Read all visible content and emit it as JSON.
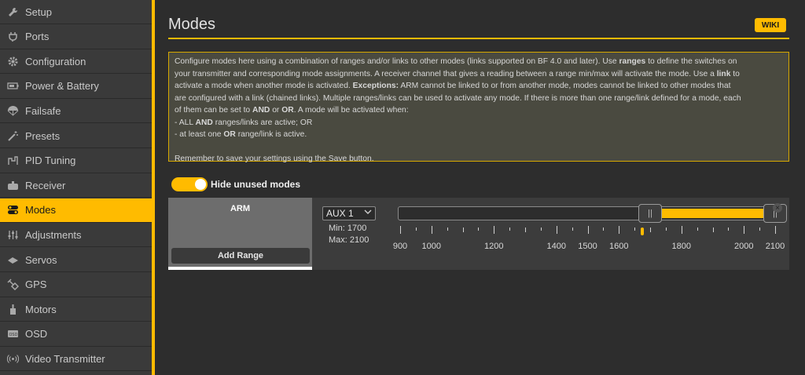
{
  "sidebar": {
    "items": [
      {
        "label": "Setup",
        "icon": "wrench-icon",
        "active": false
      },
      {
        "label": "Ports",
        "icon": "plug-icon",
        "active": false
      },
      {
        "label": "Configuration",
        "icon": "gear-icon",
        "active": false
      },
      {
        "label": "Power & Battery",
        "icon": "battery-icon",
        "active": false
      },
      {
        "label": "Failsafe",
        "icon": "parachute-icon",
        "active": false
      },
      {
        "label": "Presets",
        "icon": "magic-wand-icon",
        "active": false
      },
      {
        "label": "PID Tuning",
        "icon": "pid-tuning-icon",
        "active": false
      },
      {
        "label": "Receiver",
        "icon": "controller-icon",
        "active": false
      },
      {
        "label": "Modes",
        "icon": "modes-toggle-icon",
        "active": true
      },
      {
        "label": "Adjustments",
        "icon": "sliders-icon",
        "active": false
      },
      {
        "label": "Servos",
        "icon": "servo-icon",
        "active": false
      },
      {
        "label": "GPS",
        "icon": "satellite-icon",
        "active": false
      },
      {
        "label": "Motors",
        "icon": "motor-icon",
        "active": false
      },
      {
        "label": "OSD",
        "icon": "osd-icon",
        "active": false
      },
      {
        "label": "Video Transmitter",
        "icon": "broadcast-icon",
        "active": false
      }
    ]
  },
  "header": {
    "title": "Modes",
    "wiki_label": "WIKI"
  },
  "note": {
    "line1_a": "Configure modes here using a combination of ranges and/or links to other modes (links supported on BF 4.0 and later). Use ",
    "line1_b": "ranges",
    "line1_c": " to define the switches on",
    "line2_a": "your transmitter and corresponding mode assignments. A receiver channel that gives a reading between a range min/max will activate the mode. Use a ",
    "line2_b": "link",
    "line2_c": " to",
    "line3_a": "activate a mode when another mode is activated. ",
    "line3_b": "Exceptions:",
    "line3_c": " ARM cannot be linked to or from another mode, modes cannot be linked to other modes that",
    "line4": "are configured with a link (chained links). Multiple ranges/links can be used to activate any mode. If there is more than one range/link defined for a mode, each",
    "line5_a": "of them can be set to ",
    "line5_b": "AND",
    "line5_c": " or ",
    "line5_d": "OR",
    "line5_e": ". A mode will be activated when:",
    "line6_a": "- ALL ",
    "line6_b": "AND",
    "line6_c": " ranges/links are active; OR",
    "line7_a": "- at least one ",
    "line7_b": "OR",
    "line7_c": " range/link is active.",
    "line8": "Remember to save your settings using the Save button."
  },
  "toggle": {
    "label": "Hide unused modes",
    "on": true
  },
  "mode": {
    "name": "ARM",
    "add_range_label": "Add Range",
    "channel": "AUX 1",
    "min_label": "Min: 1700",
    "max_label": "Max: 2100",
    "range_min": 1700,
    "range_max": 2100,
    "scale_min": 900,
    "scale_max": 2100,
    "current_value": 1675,
    "tick_labels": [
      "900",
      "1000",
      "1200",
      "1400",
      "1500",
      "1600",
      "1800",
      "2000",
      "2100"
    ]
  },
  "colors": {
    "accent": "#ffbb00"
  }
}
